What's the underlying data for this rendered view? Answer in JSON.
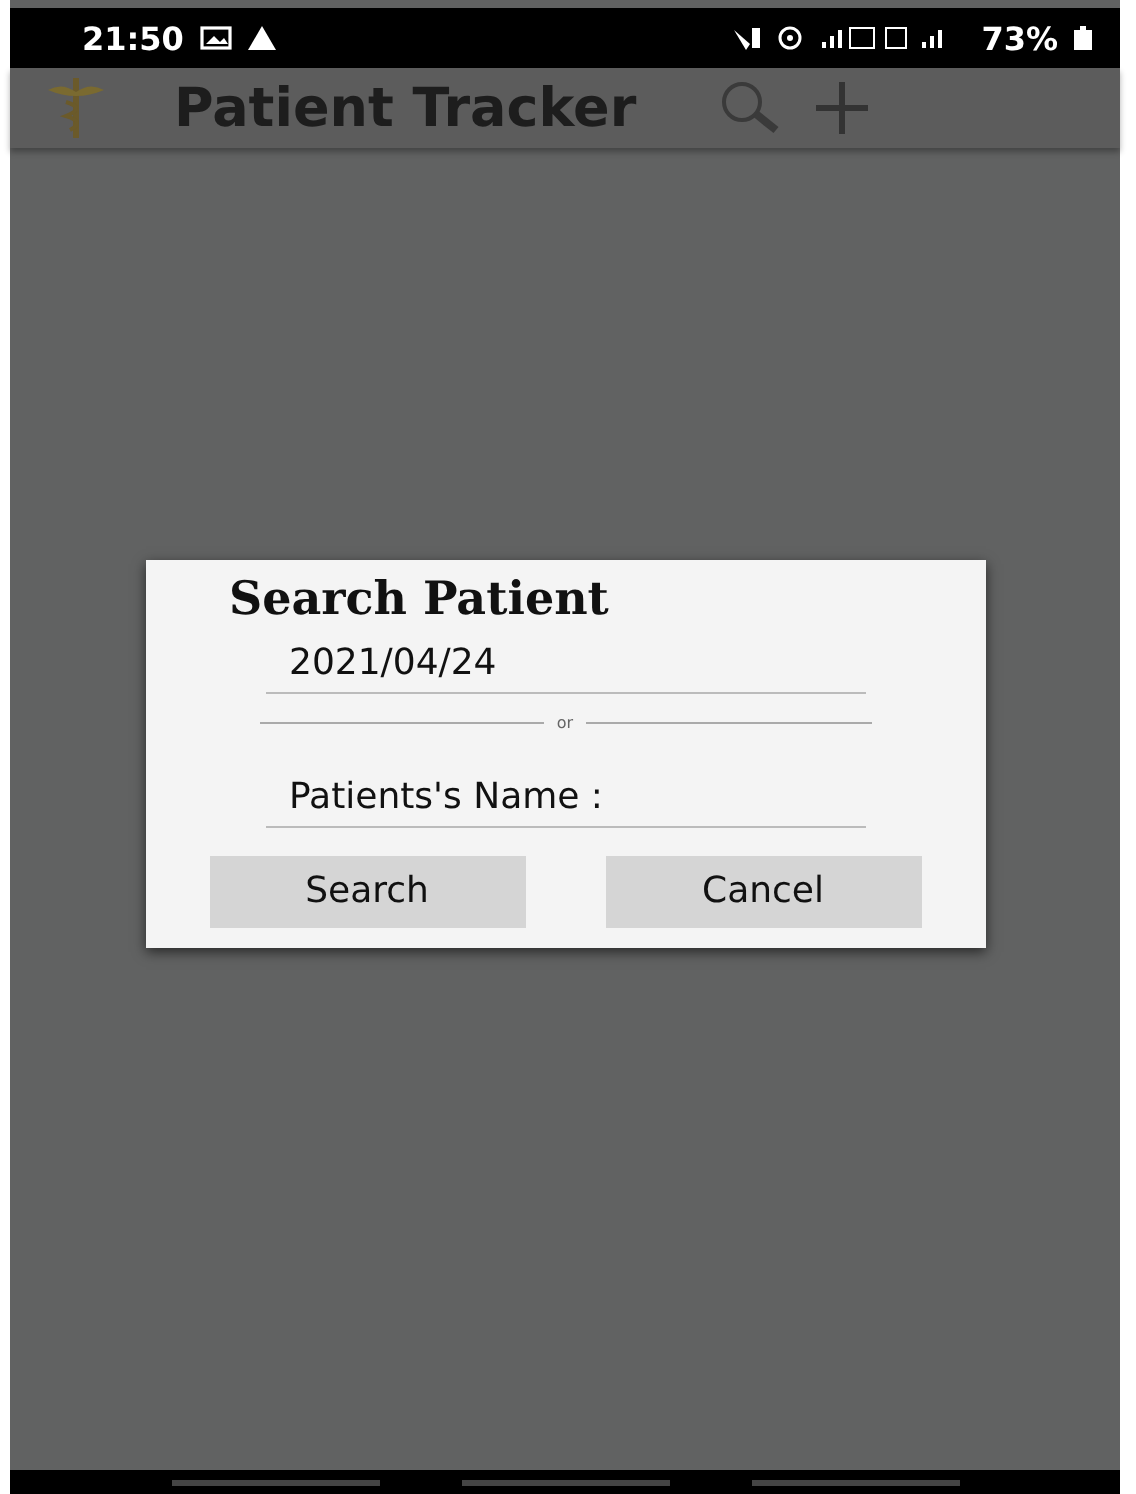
{
  "status_bar": {
    "time": "21:50",
    "battery": "73%"
  },
  "app_bar": {
    "title": "Patient Tracker"
  },
  "dialog": {
    "title": "Search Patient",
    "date_field": {
      "value": "2021/04/24"
    },
    "divider_label": "or",
    "name_field": {
      "placeholder": "Patients's Name :"
    },
    "buttons": [
      "Search",
      "Cancel"
    ]
  }
}
